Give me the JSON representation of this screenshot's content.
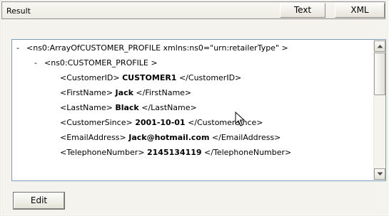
{
  "header": {
    "title": "Result",
    "text_button": "Text",
    "xml_button": "XML"
  },
  "tree": {
    "root_minus": "-",
    "root": "<ns0:ArrayOfCUSTOMER_PROFILE xmlns:ns0=\"urn:retailerType\" >",
    "child_minus": "-",
    "child": "<ns0:CUSTOMER_PROFILE >",
    "fields": [
      {
        "open": "<CustomerID>",
        "value": "CUSTOMER1",
        "close": "</CustomerID>"
      },
      {
        "open": "<FirstName>",
        "value": "Jack",
        "close": "</FirstName>"
      },
      {
        "open": "<LastName>",
        "value": "Black",
        "close": "</LastName>"
      },
      {
        "open": "<CustomerSince>",
        "value": "2001-10-01",
        "close": "</CustomerSince>"
      },
      {
        "open": "<EmailAddress>",
        "value": "Jack@hotmail.com",
        "close": "</EmailAddress>"
      },
      {
        "open": "<TelephoneNumber>",
        "value": "2145134119",
        "close": "</TelephoneNumber>"
      }
    ]
  },
  "footer": {
    "edit_button": "Edit"
  },
  "icons": {
    "scroll_up": "arrow-up-icon",
    "scroll_down": "arrow-down-icon",
    "cursor": "mouse-pointer-icon"
  }
}
